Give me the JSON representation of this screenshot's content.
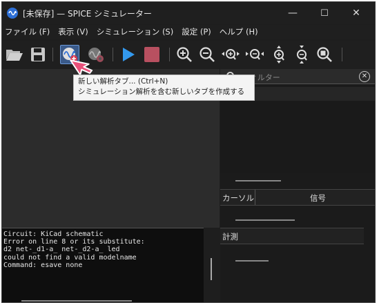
{
  "window": {
    "title": "[未保存] — SPICE シミュレーター",
    "controls": {
      "minimize": "—",
      "maximize": "☐",
      "close": "✕"
    }
  },
  "menu": [
    {
      "label": "ファイル (F)"
    },
    {
      "label": "表示 (V)"
    },
    {
      "label": "シミュレーション (S)"
    },
    {
      "label": "設定 (P)"
    },
    {
      "label": "ヘルプ (H)"
    }
  ],
  "toolbar": {
    "buttons": [
      {
        "icon": "folder-open-icon"
      },
      {
        "icon": "save-icon"
      },
      {
        "icon": "new-analysis-tab-icon"
      },
      {
        "icon": "simulation-settings-icon"
      },
      {
        "icon": "run-icon"
      },
      {
        "icon": "stop-icon"
      },
      {
        "icon": "zoom-in-icon"
      },
      {
        "icon": "zoom-out-icon"
      },
      {
        "icon": "zoom-in-horizontal-icon"
      },
      {
        "icon": "zoom-out-horizontal-icon"
      },
      {
        "icon": "zoom-in-vertical-icon"
      },
      {
        "icon": "zoom-out-vertical-icon"
      },
      {
        "icon": "zoom-fit-icon"
      }
    ]
  },
  "tooltip": {
    "line1": "新しい解析タブ... (Ctrl+N)",
    "line2": "シミュレーション解析を含む新しいタブを作成する"
  },
  "console": {
    "text": "Circuit: KiCad schematic\nError on line 8 or its substitute:\nd2 net-_d1-a_ net-_d2-a_ led\ncould not find a valid modelname\nCommand: esave none"
  },
  "signals_panel": {
    "filter_placeholder": "フィルター",
    "clear_icon": "clear-icon"
  },
  "cursor_panel": {
    "columns": [
      "カーソル",
      "信号"
    ]
  },
  "measurements_panel": {
    "label": "計測"
  },
  "colors": {
    "accent": "#2d6fd6",
    "run": "#3399ee",
    "stop": "#b85060",
    "pointer": "#e8507a"
  }
}
